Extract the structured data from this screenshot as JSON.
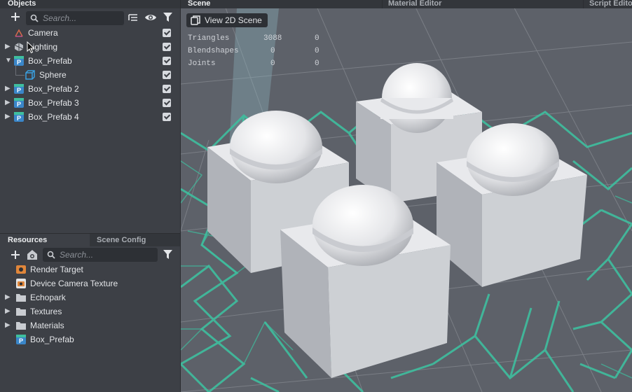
{
  "objects_panel": {
    "title": "Objects",
    "search_placeholder": "Search...",
    "items": [
      {
        "label": "Camera",
        "icon": "camera-icon",
        "expandable": false,
        "checked": true
      },
      {
        "label": "Lighting",
        "icon": "light-icon",
        "expandable": true,
        "checked": true
      },
      {
        "label": "Box_Prefab",
        "icon": "prefab-icon",
        "expandable": true,
        "expanded": true,
        "checked": true
      },
      {
        "label": "Sphere",
        "icon": "mesh-icon",
        "expandable": false,
        "checked": true
      },
      {
        "label": "Box_Prefab 2",
        "icon": "prefab-icon",
        "expandable": true,
        "checked": true
      },
      {
        "label": "Box_Prefab 3",
        "icon": "prefab-icon",
        "expandable": true,
        "checked": true
      },
      {
        "label": "Box_Prefab 4",
        "icon": "prefab-icon",
        "expandable": true,
        "checked": true
      }
    ]
  },
  "resources_panel": {
    "tabs": [
      "Resources",
      "Scene Config"
    ],
    "search_placeholder": "Search...",
    "items": [
      {
        "label": "Render Target",
        "icon": "render-target-icon",
        "expandable": false
      },
      {
        "label": "Device Camera Texture",
        "icon": "camera-texture-icon",
        "expandable": false
      },
      {
        "label": "Echopark",
        "icon": "folder-icon",
        "expandable": true
      },
      {
        "label": "Textures",
        "icon": "folder-icon",
        "expandable": true
      },
      {
        "label": "Materials",
        "icon": "folder-icon",
        "expandable": true
      },
      {
        "label": "Box_Prefab",
        "icon": "prefab-icon",
        "expandable": false
      }
    ]
  },
  "scene_panel": {
    "tabs": [
      "Scene",
      "Material Editor",
      "Script Editor"
    ],
    "view_2d_label": "View 2D Scene",
    "stats": [
      {
        "label": "Triangles",
        "value": "3088",
        "extra": "0"
      },
      {
        "label": "Blendshapes",
        "value": "0",
        "extra": "0"
      },
      {
        "label": "Joints",
        "value": "0",
        "extra": "0"
      }
    ]
  },
  "colors": {
    "accent_teal": "#3fbf9f",
    "prefab_blue": "#3a86c9",
    "panel_bg": "#3d4046"
  }
}
